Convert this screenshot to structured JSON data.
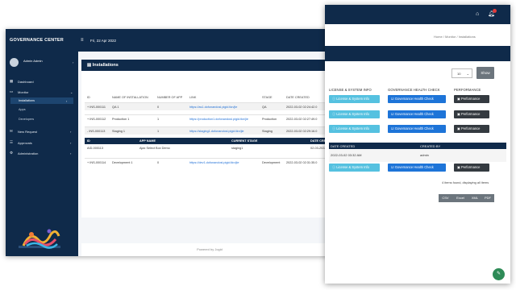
{
  "back": {
    "brand": "GOVERNANCE CENTER",
    "date": "Fri, 22 Apr 2022",
    "user": "Admin Admin",
    "nav": [
      {
        "label": "Dashboard"
      },
      {
        "label": "Monitor"
      },
      {
        "label": "Installations"
      },
      {
        "label": "Apps"
      },
      {
        "label": "Developers"
      },
      {
        "label": "New Request"
      },
      {
        "label": "Approvals"
      },
      {
        "label": "Administration"
      }
    ],
    "card_title": "Installations",
    "columns": [
      "ID",
      "NAME OF INSTALLATION",
      "NUMBER OF APP",
      "LINK",
      "STAGE",
      "DATE CREATED"
    ],
    "rows": [
      {
        "id": "+ INS-000111",
        "name": "QA 1",
        "apps": "0",
        "link": "https://as1.dofonandosl.pigid.tkn/jie",
        "stage": "QA",
        "date": "2022-03-02 02:24:42.0"
      },
      {
        "id": "+ INS-000112",
        "name": "Production 1",
        "apps": "1",
        "link": "https://production1.dofonandosl.pigid.tkn/jie",
        "stage": "Production",
        "date": "2022-03-02 02:27:49.0"
      },
      {
        "id": "- INS-000113",
        "name": "Staging 1",
        "apps": "1",
        "link": "https://staging1.dofonandosl.pigid.tkn/jie",
        "stage": "Staging",
        "date": "2022-03-02 02:29:16.0"
      }
    ],
    "subtable": {
      "cols": [
        "ID",
        "APP NAME",
        "CURRENT STAGE",
        "DATE CREATED"
      ],
      "row": {
        "id": "AID-000113",
        "name": "Ajax Select Box Demo",
        "stage": "staging1",
        "date": "02-03-2022"
      }
    },
    "row4": {
      "id": "+ INS-000114",
      "name": "Development 1",
      "apps": "0",
      "link": "https://dev1.dofonandosl.pigid.tkn/jie",
      "stage": "Development",
      "date": "2022-03-02 02:31:35.0"
    },
    "footer": "Powered by Jogid"
  },
  "front": {
    "breadcrumb": "Home  /  Monitor  /  Installations",
    "select_value": "10",
    "show_label": "Show",
    "headers": [
      "LICENSE & SYSTEM INFO",
      "GOVERNANCE HEALTH CHECK",
      "PERFORMANCE"
    ],
    "btn_license": "License & System Info",
    "btn_health": "Governance Health Check",
    "btn_perf": "Performance",
    "sub_cols": [
      "DATE CREATED",
      "CREATED BY"
    ],
    "sub_row": {
      "date": "2022-03-02 03:32 AM",
      "by": "admin"
    },
    "found": "4 items found, displaying all items",
    "exports": [
      "CSV",
      "Excel",
      "XML",
      "PDF"
    ]
  },
  "colors": {
    "navy": "#0f2a4a",
    "info": "#55c1e0",
    "primary": "#1d74d8",
    "dark": "#343a40",
    "gray": "#6c757d"
  }
}
